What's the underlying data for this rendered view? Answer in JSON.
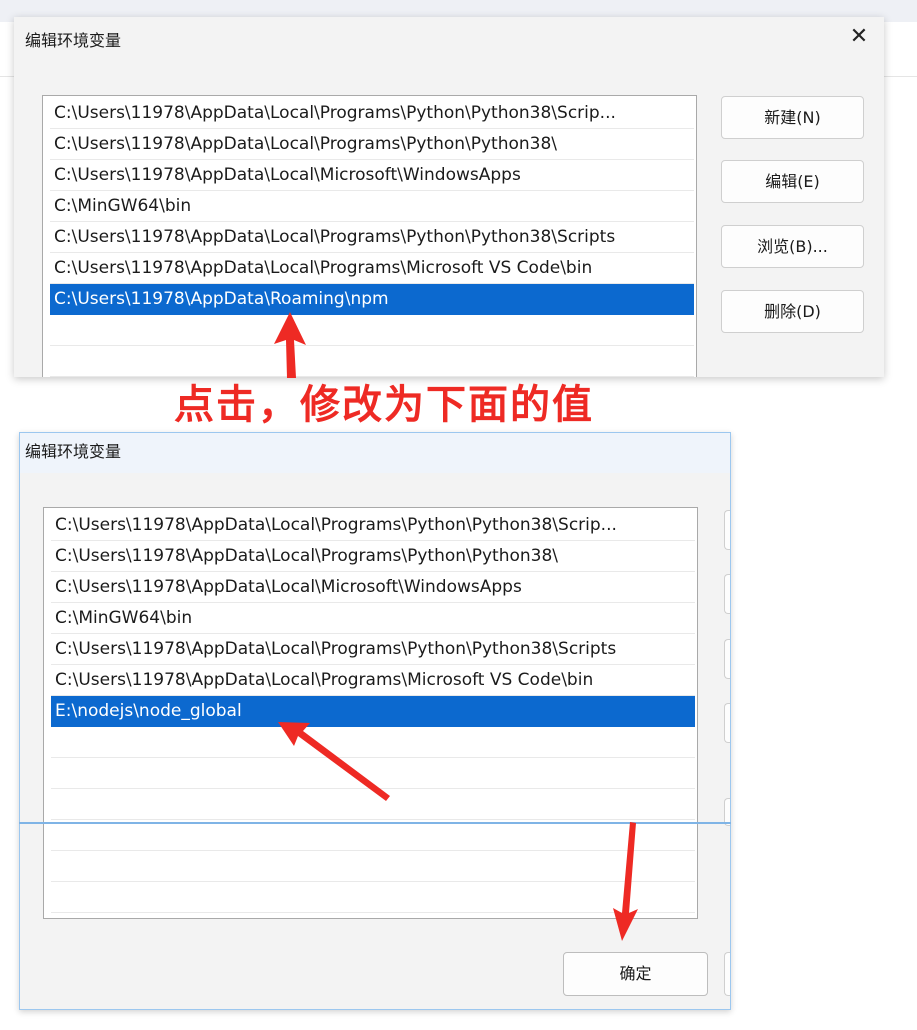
{
  "top_dialog": {
    "title": "编辑环境变量",
    "close_glyph": "✕",
    "entries": [
      "C:\\Users\\11978\\AppData\\Local\\Programs\\Python\\Python38\\Scrip...",
      "C:\\Users\\11978\\AppData\\Local\\Programs\\Python\\Python38\\",
      "C:\\Users\\11978\\AppData\\Local\\Microsoft\\WindowsApps",
      "C:\\MinGW64\\bin",
      "C:\\Users\\11978\\AppData\\Local\\Programs\\Python\\Python38\\Scripts",
      "C:\\Users\\11978\\AppData\\Local\\Programs\\Microsoft VS Code\\bin",
      "C:\\Users\\11978\\AppData\\Roaming\\npm"
    ],
    "selected_index": 6,
    "buttons": {
      "new": "新建(N)",
      "edit": "编辑(E)",
      "browse": "浏览(B)...",
      "delete": "删除(D)"
    }
  },
  "annotation_text": "点击，修改为下面的值",
  "bottom_dialog": {
    "title": "编辑环境变量",
    "entries": [
      "C:\\Users\\11978\\AppData\\Local\\Programs\\Python\\Python38\\Scrip...",
      "C:\\Users\\11978\\AppData\\Local\\Programs\\Python\\Python38\\",
      "C:\\Users\\11978\\AppData\\Local\\Microsoft\\WindowsApps",
      "C:\\MinGW64\\bin",
      "C:\\Users\\11978\\AppData\\Local\\Programs\\Python\\Python38\\Scripts",
      "C:\\Users\\11978\\AppData\\Local\\Programs\\Microsoft VS Code\\bin",
      "E:\\nodejs\\node_global"
    ],
    "selected_index": 6,
    "ok_label": "确定"
  },
  "colors": {
    "selection": "#0c69cf",
    "annotation_red": "#ee2a24",
    "dialog_bg": "#f3f3f3"
  },
  "icons": {
    "close": "close-icon",
    "arrows": "red-arrow-icon"
  }
}
